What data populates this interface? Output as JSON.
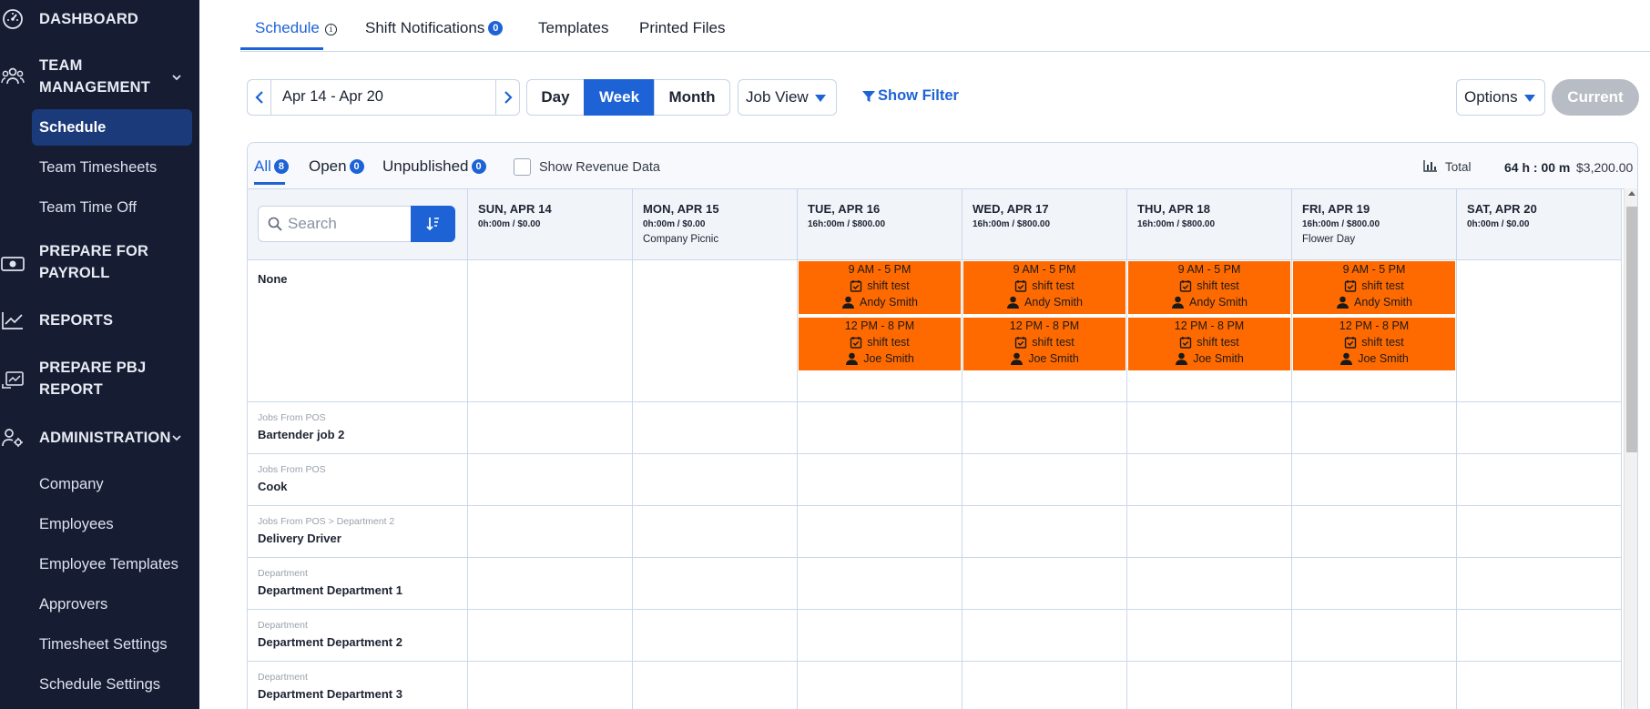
{
  "sidebar": {
    "dashboard": "DASHBOARD",
    "team_management": "TEAM MANAGEMENT",
    "team_items": [
      "Schedule",
      "Team Timesheets",
      "Team Time Off"
    ],
    "prepare_payroll": "PREPARE FOR PAYROLL",
    "reports": "REPORTS",
    "prepare_pbj": "PREPARE PBJ REPORT",
    "administration": "ADMINISTRATION",
    "admin_items": [
      "Company",
      "Employees",
      "Employee Templates",
      "Approvers",
      "Timesheet Settings",
      "Schedule Settings"
    ]
  },
  "tabs": {
    "schedule": "Schedule",
    "shift_notifications": "Shift Notifications",
    "shift_notifications_count": "0",
    "templates": "Templates",
    "printed_files": "Printed Files"
  },
  "toolbar": {
    "date_range": "Apr 14 - Apr 20",
    "day": "Day",
    "week": "Week",
    "month": "Month",
    "job_view": "Job View",
    "show_filter": "Show Filter",
    "options": "Options",
    "current": "Current"
  },
  "filters": {
    "all": "All",
    "all_count": "8",
    "open": "Open",
    "open_count": "0",
    "unpublished": "Unpublished",
    "unpublished_count": "0",
    "show_revenue": "Show Revenue Data",
    "total_label": "Total",
    "total_hours": "64 h : 00 m",
    "total_money": "$3,200.00"
  },
  "search": {
    "placeholder": "Search"
  },
  "days": [
    {
      "day": "SUN, APR 14",
      "summary": "0h:00m / $0.00",
      "event": ""
    },
    {
      "day": "MON, APR 15",
      "summary": "0h:00m / $0.00",
      "event": "Company Picnic"
    },
    {
      "day": "TUE, APR 16",
      "summary": "16h:00m / $800.00",
      "event": ""
    },
    {
      "day": "WED, APR 17",
      "summary": "16h:00m / $800.00",
      "event": ""
    },
    {
      "day": "THU, APR 18",
      "summary": "16h:00m / $800.00",
      "event": ""
    },
    {
      "day": "FRI, APR 19",
      "summary": "16h:00m / $800.00",
      "event": "Flower Day"
    },
    {
      "day": "SAT, APR 20",
      "summary": "0h:00m / $0.00",
      "event": ""
    }
  ],
  "rows": [
    {
      "category": "",
      "name": "None"
    },
    {
      "category": "Jobs From POS",
      "name": "Bartender job 2"
    },
    {
      "category": "Jobs From POS",
      "name": "Cook"
    },
    {
      "category": "Jobs From POS > Department 2",
      "name": "Delivery Driver"
    },
    {
      "category": "Department",
      "name": "Department Department 1"
    },
    {
      "category": "Department",
      "name": "Department Department 2"
    },
    {
      "category": "Department",
      "name": "Department Department 3"
    }
  ],
  "shifts": [
    {
      "day_index": 2,
      "slot": 0,
      "time": "9 AM - 5 PM",
      "title": "shift test",
      "employee": "Andy Smith"
    },
    {
      "day_index": 2,
      "slot": 1,
      "time": "12 PM - 8 PM",
      "title": "shift test",
      "employee": "Joe Smith"
    },
    {
      "day_index": 3,
      "slot": 0,
      "time": "9 AM - 5 PM",
      "title": "shift test",
      "employee": "Andy Smith"
    },
    {
      "day_index": 3,
      "slot": 1,
      "time": "12 PM - 8 PM",
      "title": "shift test",
      "employee": "Joe Smith"
    },
    {
      "day_index": 4,
      "slot": 0,
      "time": "9 AM - 5 PM",
      "title": "shift test",
      "employee": "Andy Smith"
    },
    {
      "day_index": 4,
      "slot": 1,
      "time": "12 PM - 8 PM",
      "title": "shift test",
      "employee": "Joe Smith"
    },
    {
      "day_index": 5,
      "slot": 0,
      "time": "9 AM - 5 PM",
      "title": "shift test",
      "employee": "Andy Smith"
    },
    {
      "day_index": 5,
      "slot": 1,
      "time": "12 PM - 8 PM",
      "title": "shift test",
      "employee": "Joe Smith"
    }
  ],
  "colors": {
    "accent": "#1e63d6",
    "sidebar_bg": "#161d33",
    "shift": "#ff6a00"
  }
}
